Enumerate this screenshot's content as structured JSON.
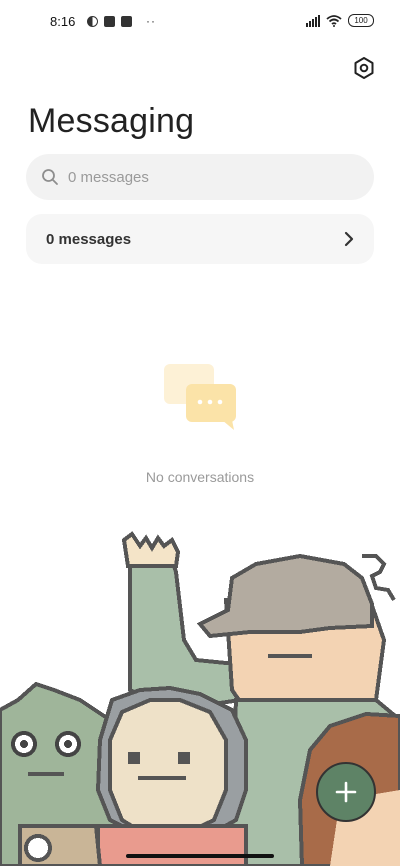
{
  "status_bar": {
    "time": "8:16",
    "dots": "··",
    "battery": "100"
  },
  "header": {
    "title": "Messaging"
  },
  "search": {
    "placeholder": "0 messages"
  },
  "messages_card": {
    "label": "0 messages"
  },
  "empty_state": {
    "text": "No conversations"
  },
  "colors": {
    "fab": "#5e8366",
    "illustration_bubbles": "#fbe3a8"
  },
  "icons": {
    "settings": "hexagon-settings-icon",
    "search": "search-icon",
    "chevron": "chevron-right-icon",
    "fab": "plus-icon"
  }
}
